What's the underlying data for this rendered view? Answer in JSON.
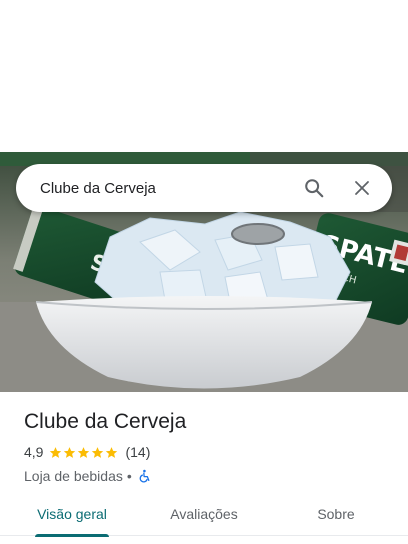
{
  "search": {
    "query": "Clube da Cerveja"
  },
  "place": {
    "name": "Clube da Cerveja",
    "rating": "4,9",
    "review_count": "(14)",
    "stars": 5,
    "category": "Loja de bebidas",
    "separator": "•"
  },
  "photo": {
    "can_label_text": "SPATEN",
    "can_sub_text": "MUNICH"
  },
  "tabs": [
    {
      "label": "Visão geral",
      "active": true
    },
    {
      "label": "Avaliações",
      "active": false
    },
    {
      "label": "Sobre",
      "active": false
    }
  ],
  "colors": {
    "accent": "#0b6c73",
    "star": "#fbbc04",
    "access": "#1a73e8"
  },
  "icons": {
    "search": "search-icon",
    "close": "close-icon",
    "access": "wheelchair-icon"
  }
}
